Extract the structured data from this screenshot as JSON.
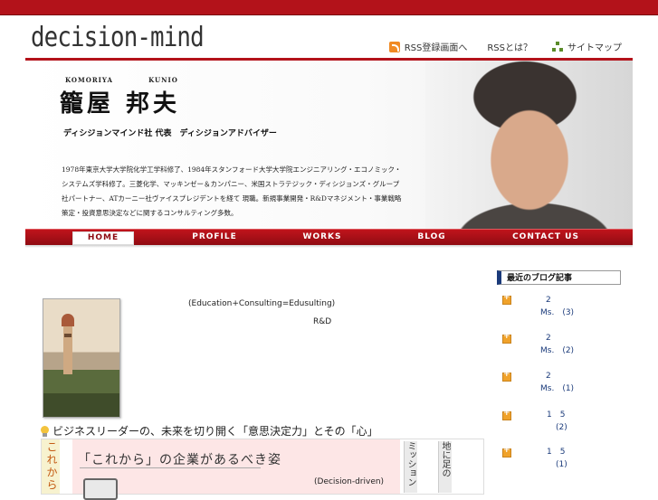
{
  "brand": {
    "logo": "decision-mind"
  },
  "header_links": [
    {
      "label": "RSS登録画面へ",
      "icon": "rss-icon"
    },
    {
      "label": "RSSとは？",
      "icon": ""
    },
    {
      "label": "サイトマップ",
      "icon": "sitemap-icon"
    }
  ],
  "profile": {
    "romaji_first": "KOMORIYA",
    "romaji_last": "KUNIO",
    "name": "籠屋 邦夫",
    "title": "ディシジョンマインド社 代表　ディシジョンアドバイザー",
    "bio": "1978年東京大学大学院化学工学科修了、1984年スタンフォード大学大学院エンジニアリング・エコノミック・システムズ学科修了。三菱化学、マッキンゼー＆カンパニー、米国ストラテジック・ディシジョンズ・グループ社パートナー、ATカーニー社ヴァイスプレジデントを経て 現職。新規事業開発・R&Dマネジメント・事業戦略策定・投資意思決定などに関するコンサルティング多数。"
  },
  "nav": {
    "items": [
      "HOME",
      "PROFILE",
      "WORKS",
      "BLOG",
      "CONTACT US"
    ],
    "active": "HOME"
  },
  "main": {
    "intro_line1": "(Education+Consulting=Edusulting)",
    "intro_line2": "R&D",
    "headline": "ビジネスリーダーの、未来を切り開く「意思決定力」とその「心」",
    "feature": {
      "side_label": "これから",
      "title": "「これから」の企業があるべき姿",
      "sub": "(Decision-driven)",
      "vertical_tabs": [
        "ミッション",
        "地に足の"
      ]
    }
  },
  "sidebar": {
    "heading": "最近のブログ記事",
    "items": [
      {
        "line1": "2",
        "line2": "Ms.　(3)"
      },
      {
        "line1": "2",
        "line2": "Ms.　(2)"
      },
      {
        "line1": "2",
        "line2": "Ms.　(1)"
      },
      {
        "line1": "1　5",
        "line2": "(2)"
      },
      {
        "line1": "1　5",
        "line2": "(1)"
      }
    ]
  },
  "colors": {
    "accent": "#b3121a",
    "sidebar_accent": "#1a3a7a",
    "feature_bg": "#fde6e6"
  }
}
